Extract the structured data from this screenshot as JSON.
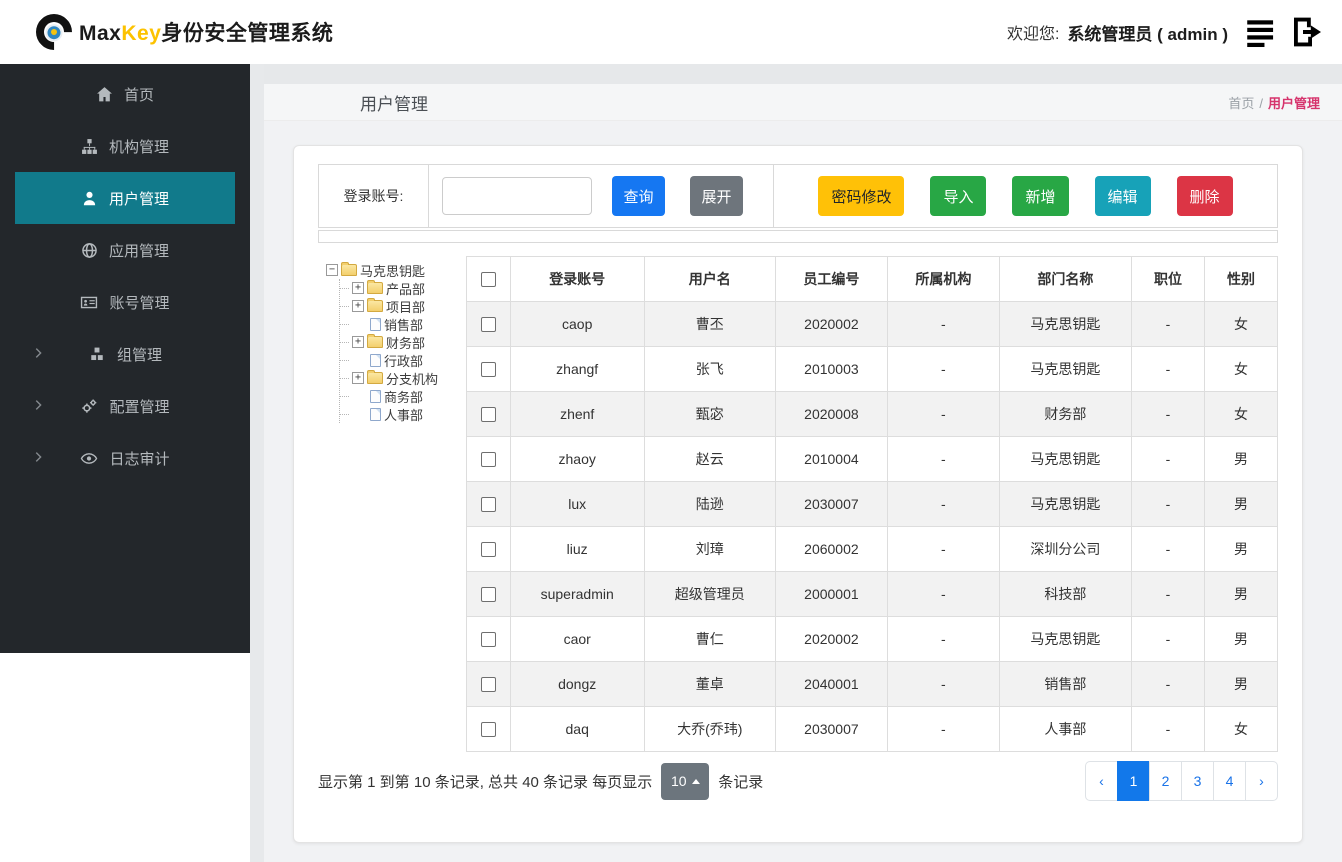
{
  "navbar": {
    "brand_max": "Max",
    "brand_key": "Key",
    "brand_suffix": "身份安全管理系统",
    "welcome_label": "欢迎您:",
    "user_display": "系统管理员 ( admin )"
  },
  "sidebar": {
    "active_color": "#117a8b",
    "items": [
      {
        "key": "home",
        "label": "首页",
        "icon": "home-icon",
        "active": false,
        "has_children": false
      },
      {
        "key": "org",
        "label": "机构管理",
        "icon": "sitemap-icon",
        "active": false,
        "has_children": false
      },
      {
        "key": "user",
        "label": "用户管理",
        "icon": "user-icon",
        "active": true,
        "has_children": false
      },
      {
        "key": "app",
        "label": "应用管理",
        "icon": "globe-icon",
        "active": false,
        "has_children": false
      },
      {
        "key": "account",
        "label": "账号管理",
        "icon": "id-card-icon",
        "active": false,
        "has_children": false
      },
      {
        "key": "group",
        "label": "组管理",
        "icon": "cubes-icon",
        "active": false,
        "has_children": true
      },
      {
        "key": "config",
        "label": "配置管理",
        "icon": "gears-icon",
        "active": false,
        "has_children": true
      },
      {
        "key": "audit",
        "label": "日志审计",
        "icon": "eye-icon",
        "active": false,
        "has_children": true
      }
    ]
  },
  "page_header": {
    "title": "用户管理",
    "breadcrumb": [
      {
        "label": "首页",
        "active": false
      },
      {
        "label": "用户管理",
        "active": true
      }
    ],
    "separator": "/"
  },
  "toolbar": {
    "search_label": "登录账号:",
    "search_value": "",
    "query_button": "查询",
    "expand_button": "展开",
    "action_buttons": [
      {
        "key": "password",
        "label": "密码修改",
        "color": "#ffc107",
        "text_color": "#212529"
      },
      {
        "key": "import",
        "label": "导入",
        "color": "#28a745",
        "text_color": "#ffffff"
      },
      {
        "key": "add",
        "label": "新增",
        "color": "#28a745",
        "text_color": "#ffffff"
      },
      {
        "key": "edit",
        "label": "编辑",
        "color": "#17a2b8",
        "text_color": "#ffffff"
      },
      {
        "key": "delete",
        "label": "删除",
        "color": "#dc3545",
        "text_color": "#ffffff"
      }
    ]
  },
  "tree": {
    "root": {
      "label": "马克思钥匙",
      "expanded": true
    },
    "children": [
      {
        "label": "产品部",
        "type": "folder",
        "expandable": true
      },
      {
        "label": "项目部",
        "type": "folder",
        "expandable": true
      },
      {
        "label": "销售部",
        "type": "file",
        "expandable": false
      },
      {
        "label": "财务部",
        "type": "folder",
        "expandable": true
      },
      {
        "label": "行政部",
        "type": "file",
        "expandable": false
      },
      {
        "label": "分支机构",
        "type": "folder",
        "expandable": true
      },
      {
        "label": "商务部",
        "type": "file",
        "expandable": false
      },
      {
        "label": "人事部",
        "type": "file",
        "expandable": false
      }
    ]
  },
  "table": {
    "columns": [
      "登录账号",
      "用户名",
      "员工编号",
      "所属机构",
      "部门名称",
      "职位",
      "性别"
    ],
    "rows": [
      [
        "caop",
        "曹丕",
        "2020002",
        "-",
        "马克思钥匙",
        "-",
        "女"
      ],
      [
        "zhangf",
        "张飞",
        "2010003",
        "-",
        "马克思钥匙",
        "-",
        "女"
      ],
      [
        "zhenf",
        "甄宓",
        "2020008",
        "-",
        "财务部",
        "-",
        "女"
      ],
      [
        "zhaoy",
        "赵云",
        "2010004",
        "-",
        "马克思钥匙",
        "-",
        "男"
      ],
      [
        "lux",
        "陆逊",
        "2030007",
        "-",
        "马克思钥匙",
        "-",
        "男"
      ],
      [
        "liuz",
        "刘璋",
        "2060002",
        "-",
        "深圳分公司",
        "-",
        "男"
      ],
      [
        "superadmin",
        "超级管理员",
        "2000001",
        "-",
        "科技部",
        "-",
        "男"
      ],
      [
        "caor",
        "曹仁",
        "2020002",
        "-",
        "马克思钥匙",
        "-",
        "男"
      ],
      [
        "dongz",
        "董卓",
        "2040001",
        "-",
        "销售部",
        "-",
        "男"
      ],
      [
        "daq",
        "大乔(乔玮)",
        "2030007",
        "-",
        "人事部",
        "-",
        "女"
      ]
    ]
  },
  "pagination": {
    "info_before": "显示第 1 到第 10 条记录, 总共 40 条记录 每页显示",
    "page_size": "10",
    "info_after": "条记录",
    "pages": [
      {
        "label": "‹",
        "active": false
      },
      {
        "label": "1",
        "active": true
      },
      {
        "label": "2",
        "active": false
      },
      {
        "label": "3",
        "active": false
      },
      {
        "label": "4",
        "active": false
      },
      {
        "label": "›",
        "active": false
      }
    ]
  },
  "colors": {
    "primary_button": "#1577f2",
    "secondary_button": "#6e757c",
    "sidebar_active": "#117a8b",
    "breadcrumb_active": "#d6336c",
    "pager_active": "#1278ea"
  }
}
